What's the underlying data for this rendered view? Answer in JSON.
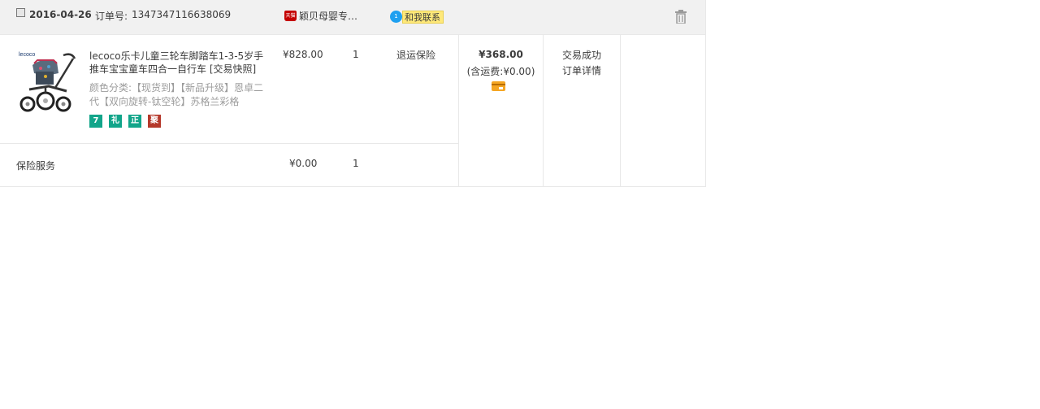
{
  "order": {
    "date": "2016-04-26",
    "order_no_label": "订单号:",
    "order_no": "1347347116638069",
    "shop_icon_text": "天猫",
    "shop_name": "颖贝母婴专…",
    "contact_icon_text": "1",
    "contact_label": "和我联系",
    "delete_icon": "trash-icon"
  },
  "item": {
    "brand_text": "lecoco",
    "title": "lecoco乐卡儿童三轮车脚踏车1-3-5岁手推车宝宝童车四合一自行车",
    "snapshot": "[交易快照]",
    "spec": "颜色分类:【现货到】【新品升级】恩卓二代【双向旋转-钛空轮】苏格兰彩格",
    "badges": [
      "7",
      "礼",
      "正",
      "聚"
    ],
    "unit_price": "¥828.00",
    "quantity": "1",
    "refund_label": "退运保险"
  },
  "service": {
    "label": "保险服务",
    "price": "¥0.00",
    "quantity": "1"
  },
  "summary": {
    "total": "¥368.00",
    "shipping": "(含运费:¥0.00)",
    "payment_icon": "credit-card-icon"
  },
  "status": {
    "text": "交易成功",
    "detail_link": "订单详情"
  },
  "colors": {
    "header_bg": "#f1f1f1",
    "border": "#e8e8e8",
    "badge_green": "#12a58a",
    "badge_red": "#b5392b",
    "contact_blue": "#1ea0f0",
    "contact_yellow": "#ffe97a",
    "shop_red": "#c40000"
  }
}
